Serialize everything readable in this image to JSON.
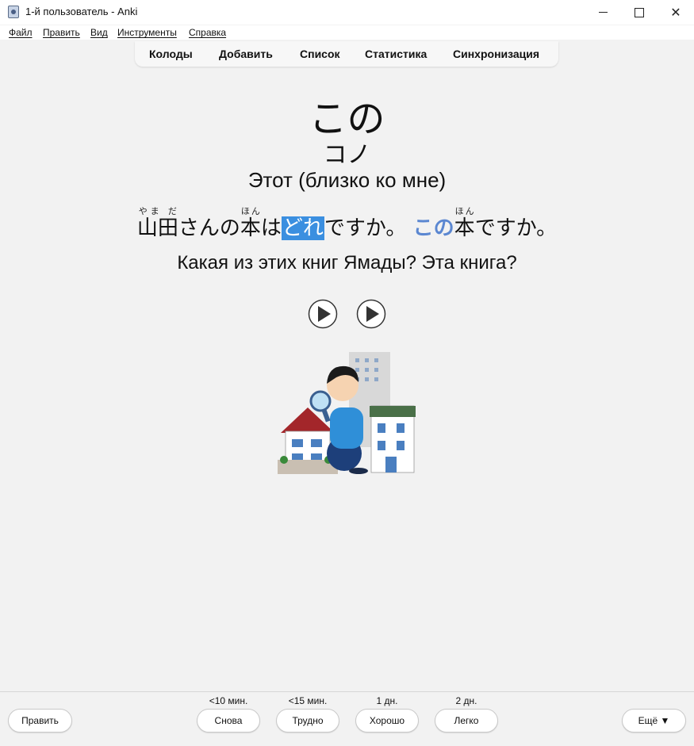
{
  "window": {
    "title": "1-й пользователь - Anki"
  },
  "menu": {
    "items": [
      "Файл",
      "Править",
      "Вид",
      "Инструменты",
      "Справка"
    ]
  },
  "toolbar": {
    "items": [
      "Колоды",
      "Добавить",
      "Список",
      "Статистика",
      "Синхронизация"
    ]
  },
  "card": {
    "word": "この",
    "reading": "コノ",
    "meaning": "Этот (близко ко мне)",
    "sentence": {
      "ruby1_base": "山田",
      "ruby1_reading": "やま だ",
      "part1": "さんの",
      "ruby2_base": "本",
      "ruby2_reading": "ほん",
      "part2": "は",
      "highlight": "どれ",
      "part3": "ですか。",
      "emph": "この",
      "ruby3_base": "本",
      "ruby3_reading": "ほん",
      "part4": "ですか。"
    },
    "translation": "Какая из этих книг Ямады? Эта книга?",
    "audio_icons": [
      "play-icon",
      "play-icon"
    ],
    "image": "man-with-magnifier-and-houses"
  },
  "bottom": {
    "edit_label": "Править",
    "more_label": "Ещё ▼",
    "answers": [
      {
        "interval": "<10 мин.",
        "label": "Снова"
      },
      {
        "interval": "<15 мин.",
        "label": "Трудно"
      },
      {
        "interval": "1 дн.",
        "label": "Хорошо"
      },
      {
        "interval": "2 дн.",
        "label": "Легко"
      }
    ]
  },
  "colors": {
    "highlight": "#3b8fe0",
    "emphasis": "#5b87d1",
    "background": "#f2f2f2"
  }
}
